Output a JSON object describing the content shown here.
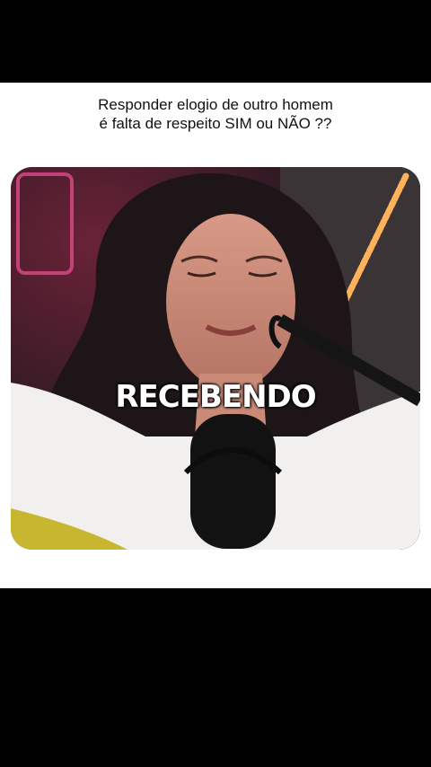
{
  "caption": {
    "line1": "Responder elogio de outro homem",
    "line2": "é falta de respeito SIM ou NÃO ??"
  },
  "video": {
    "subtitle": "RECEBENDO"
  }
}
